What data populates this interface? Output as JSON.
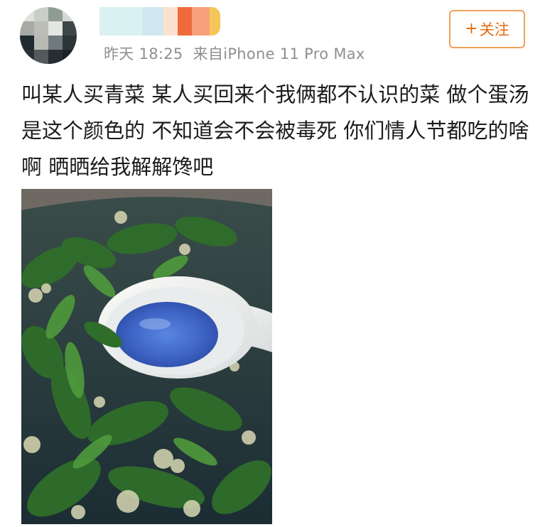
{
  "post": {
    "timestamp": "昨天 18:25",
    "source": "来自iPhone 11 Pro Max",
    "follow_button": {
      "label": "关注",
      "icon": "plus-icon"
    },
    "content": "叫某人买青菜 某人买回来个我俩都不认识的菜 做个蛋汤是这个颜色的 不知道会不会被毒死 你们情人节都吃的啥啊 晒晒给我解解馋吧",
    "photo": {
      "subject": "soup-photo"
    }
  },
  "colors": {
    "follow_text": "#e96b10",
    "follow_border": "#f3a15a",
    "meta_text": "#8f8f8f",
    "body_text": "#1c1c1c",
    "soup_blue": "#3f66c8"
  }
}
